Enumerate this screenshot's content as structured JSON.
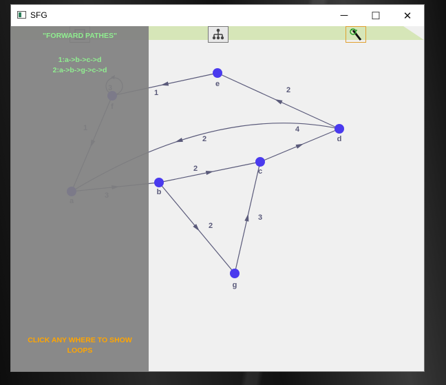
{
  "window": {
    "title": "SFG"
  },
  "window_controls": {
    "minimize": "─",
    "maximize": "☐",
    "close": "✕"
  },
  "toolbar": {
    "tools": [
      "edit-node-icon",
      "tree-graph-icon",
      "magic-wand-icon"
    ]
  },
  "panel": {
    "title": "\"FORWARD PATHES\"",
    "paths": [
      "1:a->b->c->d",
      "2:a->b->g->c->d"
    ],
    "hint_line1": "CLICK ANY WHERE TO SHOW",
    "hint_line2": "LOOPS"
  },
  "colors": {
    "node": "#4a3aee",
    "edge": "#5a5a7a",
    "panel_text": "#90ee90",
    "hint": "#ffa500",
    "toolbar": "#d6e6b8"
  },
  "graph": {
    "nodes": [
      {
        "id": "a",
        "label": "a"
      },
      {
        "id": "b",
        "label": "b"
      },
      {
        "id": "c",
        "label": "c"
      },
      {
        "id": "d",
        "label": "d"
      },
      {
        "id": "e",
        "label": "e"
      },
      {
        "id": "f",
        "label": "f"
      },
      {
        "id": "g",
        "label": "g"
      }
    ],
    "edges": [
      {
        "from": "a",
        "to": "b",
        "gain": "3"
      },
      {
        "from": "b",
        "to": "c",
        "gain": "2"
      },
      {
        "from": "c",
        "to": "d",
        "gain": "4"
      },
      {
        "from": "b",
        "to": "g",
        "gain": "2"
      },
      {
        "from": "g",
        "to": "c",
        "gain": "3"
      },
      {
        "from": "d",
        "to": "e",
        "gain": "2"
      },
      {
        "from": "e",
        "to": "f",
        "gain": "1"
      },
      {
        "from": "f",
        "to": "a",
        "gain": "1"
      },
      {
        "from": "d",
        "to": "a",
        "gain": "2"
      },
      {
        "from": "f",
        "to": "f",
        "gain": "3"
      }
    ]
  }
}
